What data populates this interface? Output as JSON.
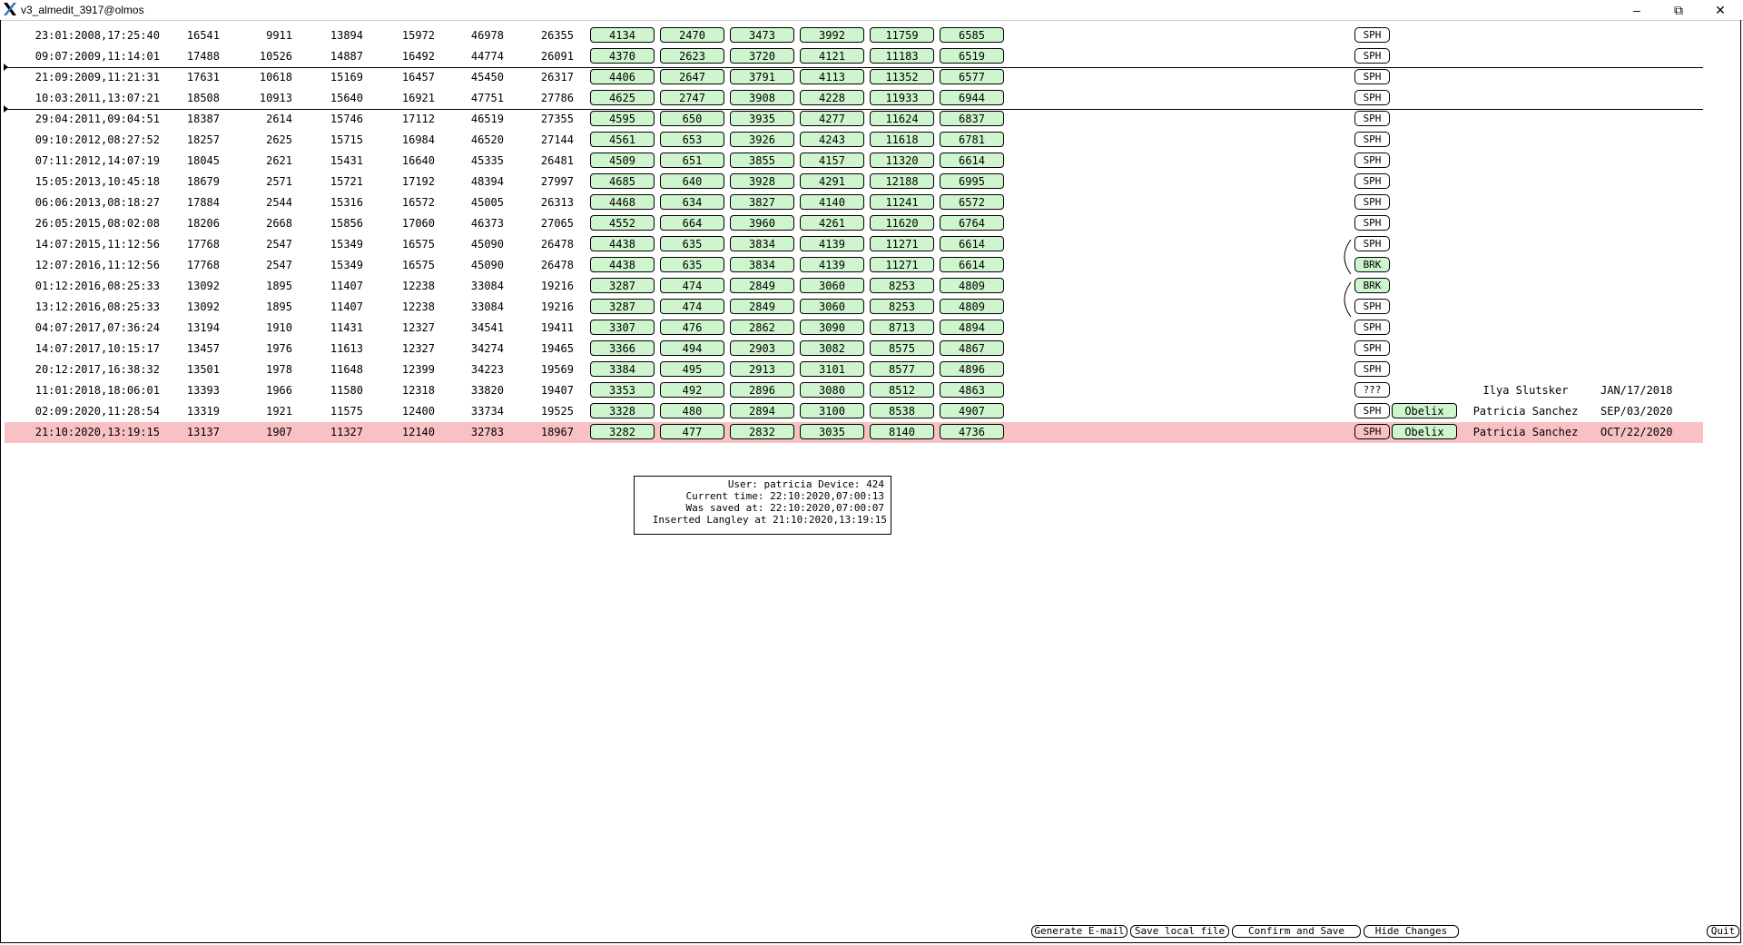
{
  "window": {
    "title": "v3_almedit_3917@olmos",
    "minimize_glyph": "–",
    "maximize_glyph": "⧉",
    "close_glyph": "✕"
  },
  "rows": [
    {
      "date": "23:01:2008,17:25:40",
      "n": [
        "16541",
        "9911",
        "13894",
        "15972",
        "46978",
        "26355"
      ],
      "g": [
        "4134",
        "2470",
        "3473",
        "3992",
        "11759",
        "6585"
      ],
      "flag": "SPH"
    },
    {
      "date": "09:07:2009,11:14:01",
      "n": [
        "17488",
        "10526",
        "14887",
        "16492",
        "44774",
        "26091"
      ],
      "g": [
        "4370",
        "2623",
        "3720",
        "4121",
        "11183",
        "6519"
      ],
      "flag": "SPH"
    },
    {
      "date": "21:09:2009,11:21:31",
      "n": [
        "17631",
        "10618",
        "15169",
        "16457",
        "45450",
        "26317"
      ],
      "g": [
        "4406",
        "2647",
        "3791",
        "4113",
        "11352",
        "6577"
      ],
      "flag": "SPH"
    },
    {
      "date": "10:03:2011,13:07:21",
      "n": [
        "18508",
        "10913",
        "15640",
        "16921",
        "47751",
        "27786"
      ],
      "g": [
        "4625",
        "2747",
        "3908",
        "4228",
        "11933",
        "6944"
      ],
      "flag": "SPH"
    },
    {
      "date": "29:04:2011,09:04:51",
      "n": [
        "18387",
        "2614",
        "15746",
        "17112",
        "46519",
        "27355"
      ],
      "g": [
        "4595",
        "650",
        "3935",
        "4277",
        "11624",
        "6837"
      ],
      "flag": "SPH"
    },
    {
      "date": "09:10:2012,08:27:52",
      "n": [
        "18257",
        "2625",
        "15715",
        "16984",
        "46520",
        "27144"
      ],
      "g": [
        "4561",
        "653",
        "3926",
        "4243",
        "11618",
        "6781"
      ],
      "flag": "SPH"
    },
    {
      "date": "07:11:2012,14:07:19",
      "n": [
        "18045",
        "2621",
        "15431",
        "16640",
        "45335",
        "26481"
      ],
      "g": [
        "4509",
        "651",
        "3855",
        "4157",
        "11320",
        "6614"
      ],
      "flag": "SPH"
    },
    {
      "date": "15:05:2013,10:45:18",
      "n": [
        "18679",
        "2571",
        "15721",
        "17192",
        "48394",
        "27997"
      ],
      "g": [
        "4685",
        "640",
        "3928",
        "4291",
        "12188",
        "6995"
      ],
      "flag": "SPH"
    },
    {
      "date": "06:06:2013,08:18:27",
      "n": [
        "17884",
        "2544",
        "15316",
        "16572",
        "45005",
        "26313"
      ],
      "g": [
        "4468",
        "634",
        "3827",
        "4140",
        "11241",
        "6572"
      ],
      "flag": "SPH"
    },
    {
      "date": "26:05:2015,08:02:08",
      "n": [
        "18206",
        "2668",
        "15856",
        "17060",
        "46373",
        "27065"
      ],
      "g": [
        "4552",
        "664",
        "3960",
        "4261",
        "11620",
        "6764"
      ],
      "flag": "SPH"
    },
    {
      "date": "14:07:2015,11:12:56",
      "n": [
        "17768",
        "2547",
        "15349",
        "16575",
        "45090",
        "26478"
      ],
      "g": [
        "4438",
        "635",
        "3834",
        "4139",
        "11271",
        "6614"
      ],
      "flag": "SPH"
    },
    {
      "date": "12:07:2016,11:12:56",
      "n": [
        "17768",
        "2547",
        "15349",
        "16575",
        "45090",
        "26478"
      ],
      "g": [
        "4438",
        "635",
        "3834",
        "4139",
        "11271",
        "6614"
      ],
      "flag": "BRK"
    },
    {
      "date": "01:12:2016,08:25:33",
      "n": [
        "13092",
        "1895",
        "11407",
        "12238",
        "33084",
        "19216"
      ],
      "g": [
        "3287",
        "474",
        "2849",
        "3060",
        "8253",
        "4809"
      ],
      "flag": "BRK"
    },
    {
      "date": "13:12:2016,08:25:33",
      "n": [
        "13092",
        "1895",
        "11407",
        "12238",
        "33084",
        "19216"
      ],
      "g": [
        "3287",
        "474",
        "2849",
        "3060",
        "8253",
        "4809"
      ],
      "flag": "SPH"
    },
    {
      "date": "04:07:2017,07:36:24",
      "n": [
        "13194",
        "1910",
        "11431",
        "12327",
        "34541",
        "19411"
      ],
      "g": [
        "3307",
        "476",
        "2862",
        "3090",
        "8713",
        "4894"
      ],
      "flag": "SPH"
    },
    {
      "date": "14:07:2017,10:15:17",
      "n": [
        "13457",
        "1976",
        "11613",
        "12327",
        "34274",
        "19465"
      ],
      "g": [
        "3366",
        "494",
        "2903",
        "3082",
        "8575",
        "4867"
      ],
      "flag": "SPH"
    },
    {
      "date": "20:12:2017,16:38:32",
      "n": [
        "13501",
        "1978",
        "11648",
        "12399",
        "34223",
        "19569"
      ],
      "g": [
        "3384",
        "495",
        "2913",
        "3101",
        "8577",
        "4896"
      ],
      "flag": "SPH"
    },
    {
      "date": "11:01:2018,18:06:01",
      "n": [
        "13393",
        "1966",
        "11580",
        "12318",
        "33820",
        "19407"
      ],
      "g": [
        "3353",
        "492",
        "2896",
        "3080",
        "8512",
        "4863"
      ],
      "flag": "???",
      "user": "Ilya Slutsker",
      "udate": "JAN/17/2018"
    },
    {
      "date": "02:09:2020,11:28:54",
      "n": [
        "13319",
        "1921",
        "11575",
        "12400",
        "33734",
        "19525"
      ],
      "g": [
        "3328",
        "480",
        "2894",
        "3100",
        "8538",
        "4907"
      ],
      "flag": "SPH",
      "obelix": "Obelix",
      "user": "Patricia Sanchez",
      "udate": "SEP/03/2020"
    },
    {
      "date": "21:10:2020,13:19:15",
      "n": [
        "13137",
        "1907",
        "11327",
        "12140",
        "32783",
        "18967"
      ],
      "g": [
        "3282",
        "477",
        "2832",
        "3035",
        "8140",
        "4736"
      ],
      "flag": "SPH",
      "obelix": "Obelix",
      "user": "Patricia Sanchez",
      "udate": "OCT/22/2020",
      "selected": true
    }
  ],
  "info": {
    "line1": "User: patricia Device: 424",
    "line2": "Current time: 22:10:2020,07:00:13",
    "line3": "Was saved at: 22:10:2020,07:00:07",
    "line4": "Inserted Langley at 21:10:2020,13:19:15"
  },
  "buttons": {
    "generate_email": "Generate E-mail",
    "save_local": "Save local file",
    "confirm_save": "Confirm and Save",
    "hide_changes": "Hide Changes",
    "quit": "Quit"
  },
  "colors": {
    "value_box": "#cff5cf",
    "selected_row": "#f9c1c4"
  }
}
